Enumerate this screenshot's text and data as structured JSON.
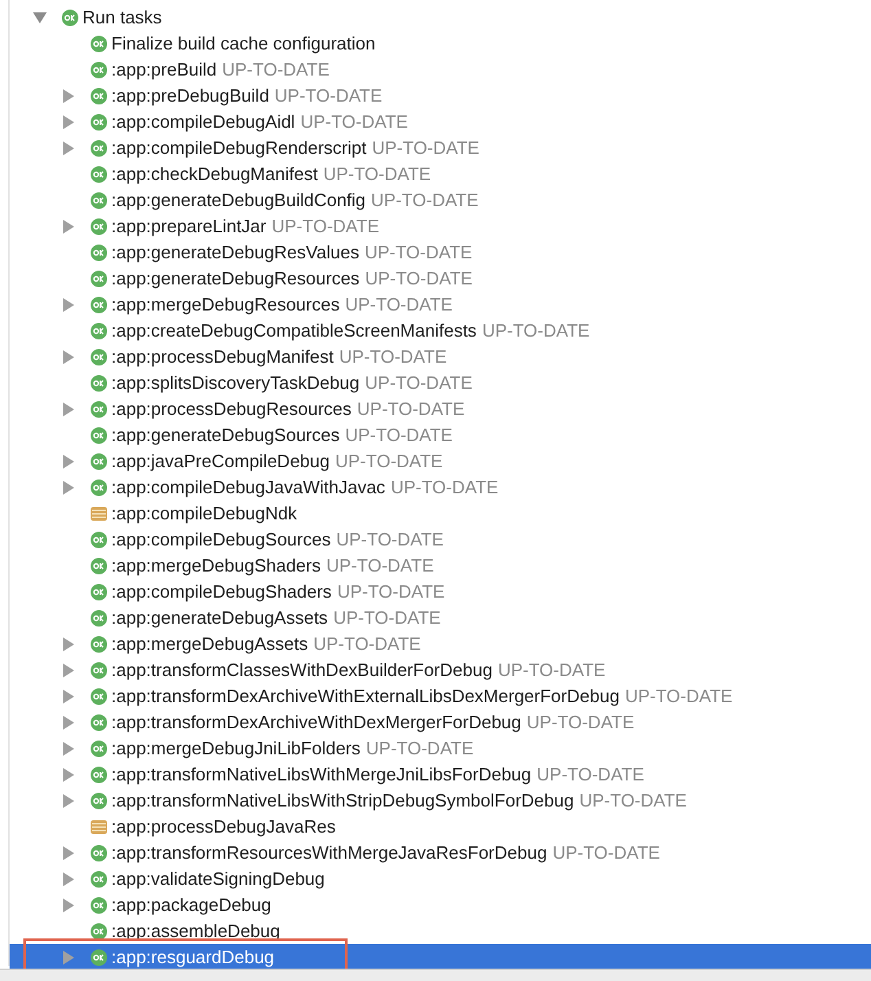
{
  "tree": {
    "label": "Run tasks",
    "kind": "ok",
    "expanded": true,
    "selected": false,
    "children": [
      {
        "label": "Finalize build cache configuration",
        "kind": "ok",
        "expandable": false,
        "selected": false
      },
      {
        "label": ":app:preBuild",
        "status": "UP-TO-DATE",
        "kind": "ok",
        "expandable": false,
        "selected": false
      },
      {
        "label": ":app:preDebugBuild",
        "status": "UP-TO-DATE",
        "kind": "ok",
        "expandable": true,
        "selected": false
      },
      {
        "label": ":app:compileDebugAidl",
        "status": "UP-TO-DATE",
        "kind": "ok",
        "expandable": true,
        "selected": false
      },
      {
        "label": ":app:compileDebugRenderscript",
        "status": "UP-TO-DATE",
        "kind": "ok",
        "expandable": true,
        "selected": false
      },
      {
        "label": ":app:checkDebugManifest",
        "status": "UP-TO-DATE",
        "kind": "ok",
        "expandable": false,
        "selected": false
      },
      {
        "label": ":app:generateDebugBuildConfig",
        "status": "UP-TO-DATE",
        "kind": "ok",
        "expandable": false,
        "selected": false
      },
      {
        "label": ":app:prepareLintJar",
        "status": "UP-TO-DATE",
        "kind": "ok",
        "expandable": true,
        "selected": false
      },
      {
        "label": ":app:generateDebugResValues",
        "status": "UP-TO-DATE",
        "kind": "ok",
        "expandable": false,
        "selected": false
      },
      {
        "label": ":app:generateDebugResources",
        "status": "UP-TO-DATE",
        "kind": "ok",
        "expandable": false,
        "selected": false
      },
      {
        "label": ":app:mergeDebugResources",
        "status": "UP-TO-DATE",
        "kind": "ok",
        "expandable": true,
        "selected": false
      },
      {
        "label": ":app:createDebugCompatibleScreenManifests",
        "status": "UP-TO-DATE",
        "kind": "ok",
        "expandable": false,
        "selected": false
      },
      {
        "label": ":app:processDebugManifest",
        "status": "UP-TO-DATE",
        "kind": "ok",
        "expandable": true,
        "selected": false
      },
      {
        "label": ":app:splitsDiscoveryTaskDebug",
        "status": "UP-TO-DATE",
        "kind": "ok",
        "expandable": false,
        "selected": false
      },
      {
        "label": ":app:processDebugResources",
        "status": "UP-TO-DATE",
        "kind": "ok",
        "expandable": true,
        "selected": false
      },
      {
        "label": ":app:generateDebugSources",
        "status": "UP-TO-DATE",
        "kind": "ok",
        "expandable": false,
        "selected": false
      },
      {
        "label": ":app:javaPreCompileDebug",
        "status": "UP-TO-DATE",
        "kind": "ok",
        "expandable": true,
        "selected": false
      },
      {
        "label": ":app:compileDebugJavaWithJavac",
        "status": "UP-TO-DATE",
        "kind": "ok",
        "expandable": true,
        "selected": false
      },
      {
        "label": ":app:compileDebugNdk",
        "kind": "skipped",
        "expandable": false,
        "selected": false
      },
      {
        "label": ":app:compileDebugSources",
        "status": "UP-TO-DATE",
        "kind": "ok",
        "expandable": false,
        "selected": false
      },
      {
        "label": ":app:mergeDebugShaders",
        "status": "UP-TO-DATE",
        "kind": "ok",
        "expandable": false,
        "selected": false
      },
      {
        "label": ":app:compileDebugShaders",
        "status": "UP-TO-DATE",
        "kind": "ok",
        "expandable": false,
        "selected": false
      },
      {
        "label": ":app:generateDebugAssets",
        "status": "UP-TO-DATE",
        "kind": "ok",
        "expandable": false,
        "selected": false
      },
      {
        "label": ":app:mergeDebugAssets",
        "status": "UP-TO-DATE",
        "kind": "ok",
        "expandable": true,
        "selected": false
      },
      {
        "label": ":app:transformClassesWithDexBuilderForDebug",
        "status": "UP-TO-DATE",
        "kind": "ok",
        "expandable": true,
        "selected": false
      },
      {
        "label": ":app:transformDexArchiveWithExternalLibsDexMergerForDebug",
        "status": "UP-TO-DATE",
        "kind": "ok",
        "expandable": true,
        "selected": false
      },
      {
        "label": ":app:transformDexArchiveWithDexMergerForDebug",
        "status": "UP-TO-DATE",
        "kind": "ok",
        "expandable": true,
        "selected": false
      },
      {
        "label": ":app:mergeDebugJniLibFolders",
        "status": "UP-TO-DATE",
        "kind": "ok",
        "expandable": true,
        "selected": false
      },
      {
        "label": ":app:transformNativeLibsWithMergeJniLibsForDebug",
        "status": "UP-TO-DATE",
        "kind": "ok",
        "expandable": true,
        "selected": false
      },
      {
        "label": ":app:transformNativeLibsWithStripDebugSymbolForDebug",
        "status": "UP-TO-DATE",
        "kind": "ok",
        "expandable": true,
        "selected": false
      },
      {
        "label": ":app:processDebugJavaRes",
        "kind": "skipped",
        "expandable": false,
        "selected": false
      },
      {
        "label": ":app:transformResourcesWithMergeJavaResForDebug",
        "status": "UP-TO-DATE",
        "kind": "ok",
        "expandable": true,
        "selected": false
      },
      {
        "label": ":app:validateSigningDebug",
        "kind": "ok",
        "expandable": true,
        "selected": false
      },
      {
        "label": ":app:packageDebug",
        "kind": "ok",
        "expandable": true,
        "selected": false
      },
      {
        "label": ":app:assembleDebug",
        "kind": "ok",
        "expandable": false,
        "selected": false
      },
      {
        "label": ":app:resguardDebug",
        "kind": "ok",
        "expandable": true,
        "selected": true,
        "highlighted": true
      }
    ]
  }
}
